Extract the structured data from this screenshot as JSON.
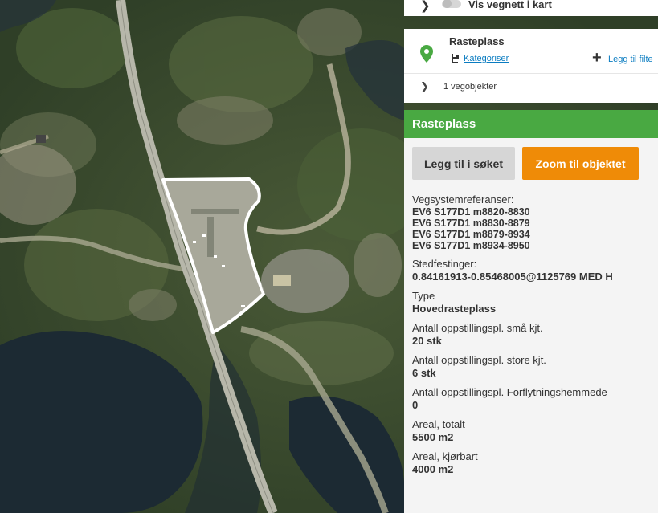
{
  "layers": {
    "show_network_label": "Vis vegnett i kart"
  },
  "filter": {
    "title": "Rasteplass",
    "categorize_label": "Kategoriser",
    "add_filter_label": "Legg til filte",
    "objects_count": "1 vegobjekter"
  },
  "details": {
    "title": "Rasteplass",
    "add_to_search_label": "Legg til i søket",
    "zoom_label": "Zoom til objektet",
    "properties": [
      {
        "label": "Vegsystemreferanser:",
        "value": "EV6 S177D1 m8820-8830"
      },
      {
        "label": "",
        "value": "EV6 S177D1 m8830-8879"
      },
      {
        "label": "",
        "value": "EV6 S177D1 m8879-8934"
      },
      {
        "label": "",
        "value": "EV6 S177D1 m8934-8950"
      },
      {
        "label": "Stedfestinger:",
        "value": "0.84161913-0.85468005@1125769 MED H"
      },
      {
        "label": "Type",
        "value": "Hovedrasteplass"
      },
      {
        "label": "Antall oppstillingspl. små kjt.",
        "value": "20 stk"
      },
      {
        "label": "Antall oppstillingspl. store kjt.",
        "value": "6 stk"
      },
      {
        "label": "Antall oppstillingspl. Forflytningshemmede",
        "value": "0"
      },
      {
        "label": "Areal, totalt",
        "value": "5500 m2"
      },
      {
        "label": "Areal, kjørbart",
        "value": "4000 m2"
      }
    ]
  },
  "colors": {
    "accent_green": "#49a942",
    "zoom_orange": "#ef8b07",
    "link_blue": "#0a7cc1"
  },
  "icons": {
    "expand": "chevron-right-icon",
    "pin": "map-pin-icon",
    "categorize": "tree-icon",
    "add": "plus-icon"
  }
}
